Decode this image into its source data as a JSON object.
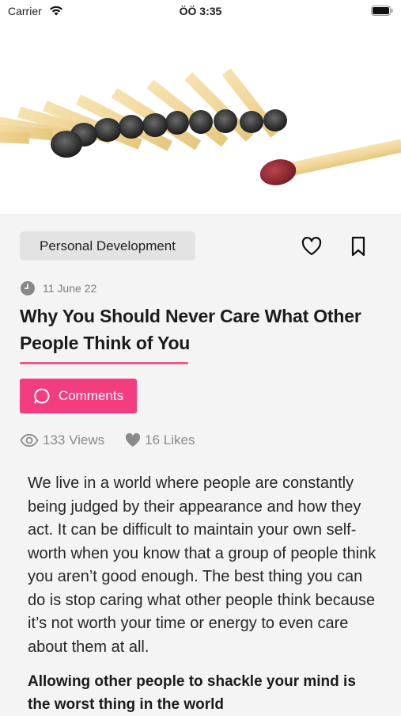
{
  "status_bar": {
    "carrier": "Carrier",
    "time": "ÖÖ 3:35",
    "icons": [
      "wifi-icon",
      "battery-icon"
    ]
  },
  "hero": {
    "icon": "burnt-matches-image"
  },
  "article": {
    "category": "Personal Development",
    "date": "11 June 22",
    "title": "Why You Should Never Care What Other People Think of You",
    "comments_label": "Comments",
    "views": "133 Views",
    "likes": "16 Likes",
    "body": "We live in a world where people are constantly being judged by their appearance and how they act. It can be difficult to maintain your own self-worth when you know that a group of people think you aren’t good enough. The best thing you can do is stop caring what other people think because it’s not worth your time or energy to even care about them at all.",
    "subheading": "Allowing other people to shackle your mind is the worst thing in the world"
  },
  "colors": {
    "accent": "#f43d80",
    "underline": "#f0588e",
    "chip_bg": "#e3e3e3",
    "page_bg": "#f4f4f4"
  }
}
